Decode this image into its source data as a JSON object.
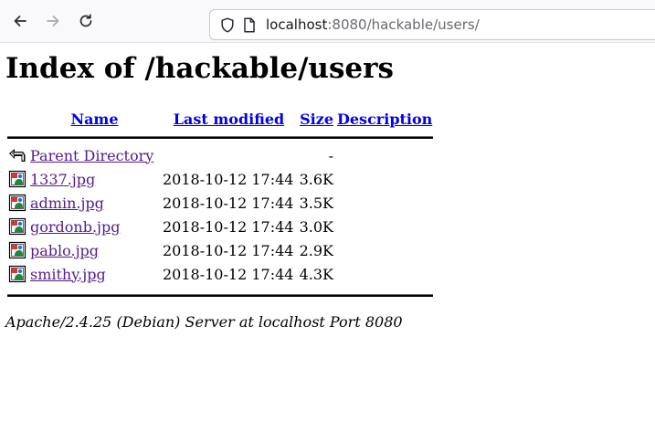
{
  "browser": {
    "url_host": "localhost",
    "url_path": ":8080/hackable/users/"
  },
  "page": {
    "title": "Index of /hackable/users",
    "headers": {
      "name": "Name",
      "last_modified": "Last modified",
      "size": "Size",
      "description": "Description"
    },
    "parent": {
      "name": "Parent Directory",
      "size": "-",
      "icon": "back-icon"
    },
    "files": [
      {
        "name": "1337.jpg",
        "modified": "2018-10-12 17:44",
        "size": "3.6K",
        "icon": "image-icon"
      },
      {
        "name": "admin.jpg",
        "modified": "2018-10-12 17:44",
        "size": "3.5K",
        "icon": "image-icon"
      },
      {
        "name": "gordonb.jpg",
        "modified": "2018-10-12 17:44",
        "size": "3.0K",
        "icon": "image-icon"
      },
      {
        "name": "pablo.jpg",
        "modified": "2018-10-12 17:44",
        "size": "2.9K",
        "icon": "image-icon"
      },
      {
        "name": "smithy.jpg",
        "modified": "2018-10-12 17:44",
        "size": "4.3K",
        "icon": "image-icon"
      }
    ],
    "footer": "Apache/2.4.25 (Debian) Server at localhost Port 8080"
  },
  "colors": {
    "link": "#0000ee",
    "visited": "#551a8b"
  }
}
